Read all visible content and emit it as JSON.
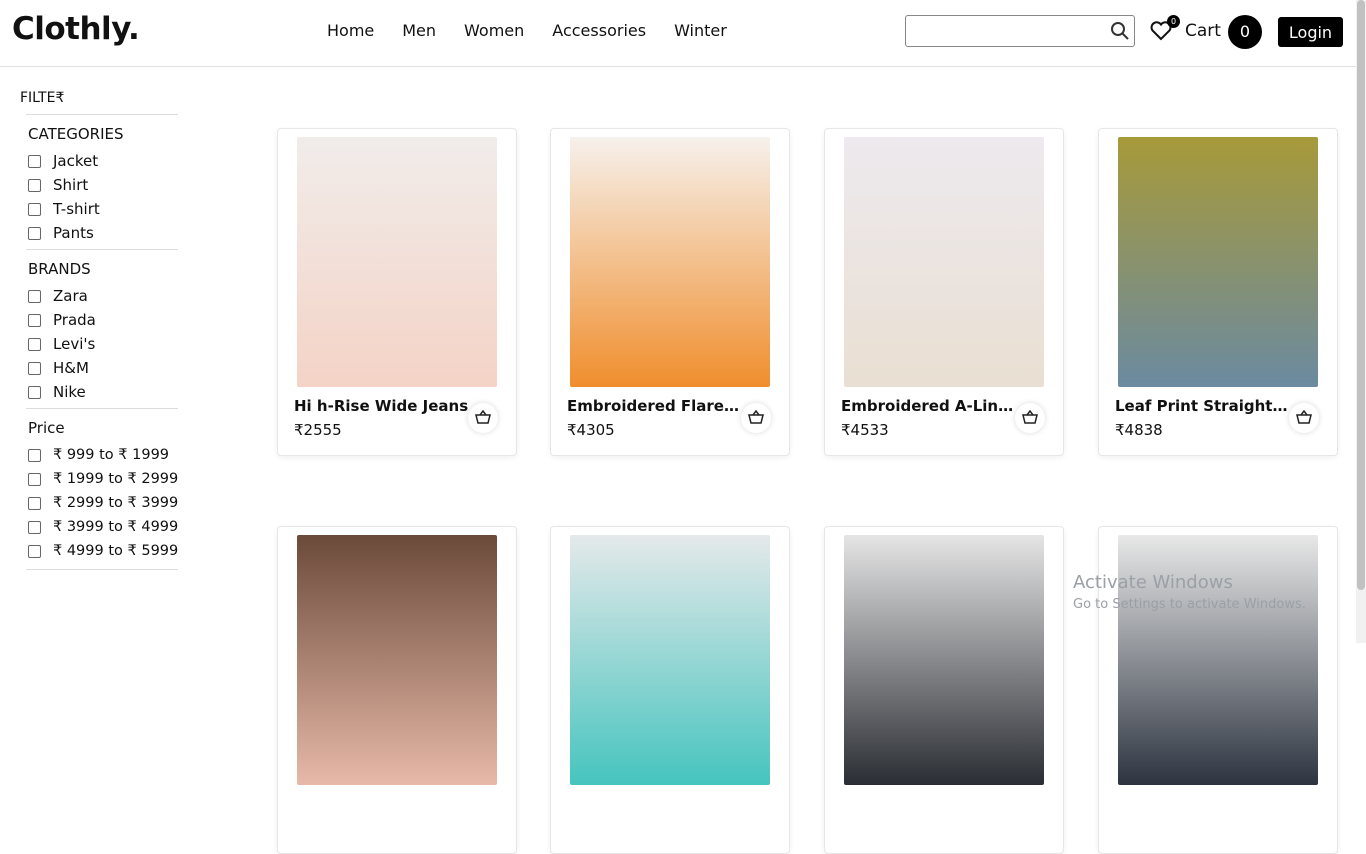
{
  "brand": "Clothly.",
  "nav": [
    "Home",
    "Men",
    "Women",
    "Accessories",
    "Winter"
  ],
  "search": {
    "placeholder": ""
  },
  "wishlist_count": "0",
  "cart": {
    "label": "Cart",
    "count": "0"
  },
  "login_label": "Login",
  "filters": {
    "title": "FILTE₹",
    "categories_title": "CATEGORIES",
    "categories": [
      "Jacket",
      "Shirt",
      "T-shirt",
      "Pants"
    ],
    "brands_title": "BRANDS",
    "brands": [
      "Zara",
      "Prada",
      "Levi's",
      "H&M",
      "Nike"
    ],
    "price_title": "Price",
    "prices": [
      "₹ 999 to ₹ 1999",
      "₹ 1999 to ₹ 2999",
      "₹ 2999 to ₹ 3999",
      "₹ 3999 to ₹ 4999",
      "₹ 4999 to ₹ 5999"
    ]
  },
  "products": [
    {
      "name": "Hi h-Rise Wide Jeans",
      "price": "₹2555",
      "colors": [
        "#f1ecea",
        "#f4d3c6"
      ]
    },
    {
      "name": "Embroidered Flared Kurta",
      "price": "₹4305",
      "colors": [
        "#f6f1ec",
        "#f08e2d"
      ]
    },
    {
      "name": "Embroidered A-Line Top",
      "price": "₹4533",
      "colors": [
        "#ede9ee",
        "#e9dfd2"
      ]
    },
    {
      "name": "Leaf Print Straight Pants",
      "price": "₹4838",
      "colors": [
        "#a79a39",
        "#6b8aa1"
      ]
    }
  ],
  "products_row2": [
    {
      "colors": [
        "#6b4a3a",
        "#e7b9a8"
      ]
    },
    {
      "colors": [
        "#e5e9ea",
        "#46c4be"
      ]
    },
    {
      "colors": [
        "#e5e5e5",
        "#2a2d33"
      ]
    },
    {
      "colors": [
        "#e8e8e8",
        "#2d3440"
      ]
    }
  ],
  "os_watermark": {
    "title": "Activate Windows",
    "subtitle": "Go to Settings to activate Windows."
  }
}
